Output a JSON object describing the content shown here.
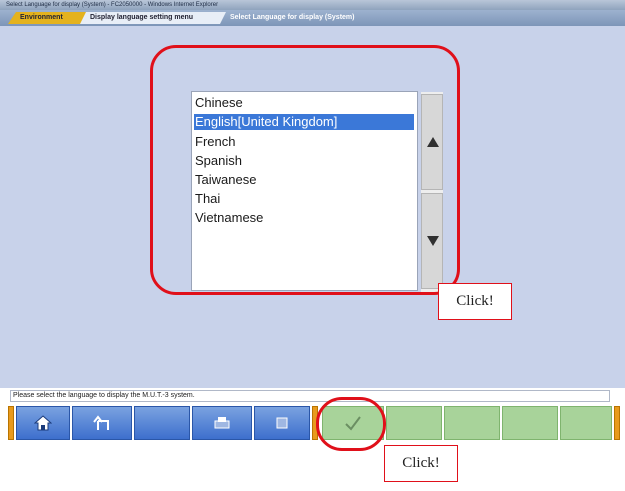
{
  "window": {
    "title": "Select Language for display (System) - FC2050000 - Windows Internet Explorer"
  },
  "breadcrumb": {
    "items": [
      "Environment",
      "Display language setting menu"
    ],
    "current": "Select Language for display (System)"
  },
  "language_list": {
    "items": [
      "Chinese",
      "English[United Kingdom]",
      "French",
      "Spanish",
      "Taiwanese",
      "Thai",
      "Vietnamese"
    ],
    "selected": "English[United Kingdom]"
  },
  "scroll": {
    "up_icon": "triangle-up-icon",
    "down_icon": "triangle-down-icon"
  },
  "callouts": {
    "list": "Click!",
    "ok": "Click!"
  },
  "status_text": "Please select the language to display the M.U.T.-3 system.",
  "toolbar": {
    "icons": [
      "home-icon",
      "back-arrow-icon",
      "print-icon",
      "stop-icon",
      "checkmark-icon"
    ],
    "colors": {
      "blue": "#3d6fcd",
      "green": "#a8d39a",
      "orange": "#e89a1c",
      "highlight": "#e0101a"
    }
  }
}
